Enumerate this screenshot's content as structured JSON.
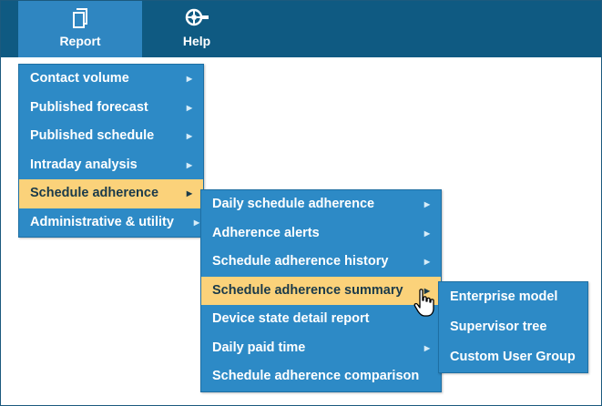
{
  "topbar": {
    "report": {
      "label": "Report",
      "icon": "document-icon"
    },
    "help": {
      "label": "Help",
      "icon": "help-wheel-icon"
    }
  },
  "colors": {
    "topbar": "#0f5a82",
    "menu": "#2d8ac6",
    "active": "#fbd27a"
  },
  "report_menu": {
    "items": [
      {
        "label": "Contact volume"
      },
      {
        "label": "Published forecast"
      },
      {
        "label": "Published schedule"
      },
      {
        "label": "Intraday analysis"
      },
      {
        "label": "Schedule adherence"
      },
      {
        "label": "Administrative & utility"
      }
    ]
  },
  "adherence_menu": {
    "items": [
      {
        "label": "Daily schedule adherence"
      },
      {
        "label": "Adherence alerts"
      },
      {
        "label": "Schedule adherence history"
      },
      {
        "label": "Schedule adherence summary"
      },
      {
        "label": "Device state detail report"
      },
      {
        "label": "Daily paid time"
      },
      {
        "label": "Schedule adherence comparison"
      }
    ]
  },
  "summary_menu": {
    "items": [
      {
        "label": "Enterprise model"
      },
      {
        "label": "Supervisor tree"
      },
      {
        "label": "Custom User Group"
      }
    ]
  }
}
